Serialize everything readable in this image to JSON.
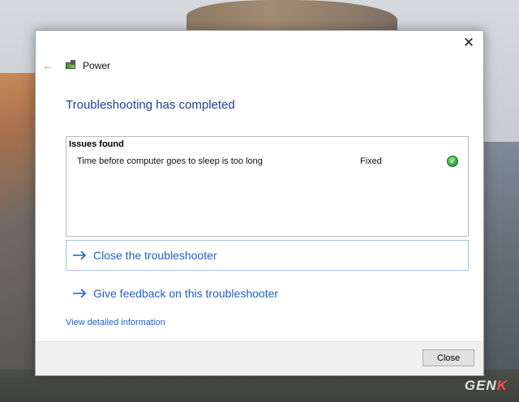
{
  "window": {
    "header_title": "Power",
    "close_glyph": "✕",
    "back_glyph": "←"
  },
  "main": {
    "title": "Troubleshooting has completed",
    "issues": {
      "header": "Issues found",
      "rows": [
        {
          "description": "Time before computer goes to sleep is too long",
          "status": "Fixed",
          "status_icon": "check-icon"
        }
      ]
    },
    "actions": [
      {
        "label": "Close the troubleshooter"
      },
      {
        "label": "Give feedback on this troubleshooter"
      }
    ],
    "detail_link": "View detailed information"
  },
  "footer": {
    "close_label": "Close"
  },
  "watermark": {
    "text": "GEN",
    "accent": "K"
  },
  "colors": {
    "accent_blue": "#1f61c4",
    "title_blue": "#1f3f95",
    "success_green": "#3aa845"
  }
}
